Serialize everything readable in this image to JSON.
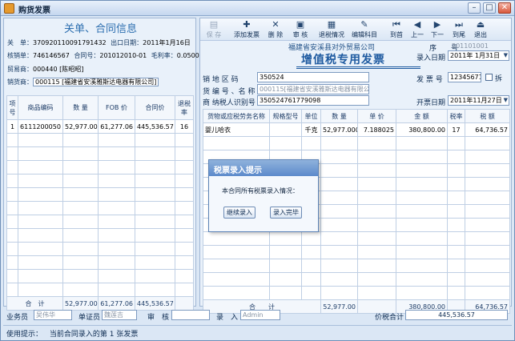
{
  "window": {
    "title": "购货发票"
  },
  "left": {
    "title": "关单、合同信息",
    "customs_label": "关　单：",
    "customs_no": "370920110091791432",
    "export_date_label": "出口日期：",
    "export_date": "2011年1月16日",
    "verify_label": "核销单：",
    "verify_no": "746146567",
    "contract_label": "合同号：",
    "contract_no": "201012010-01",
    "margin_label": "毛利率：",
    "margin": "0.0500",
    "trader_label": "贸易商：",
    "trader": "000440 [陈昭昭]",
    "supplier_label": "销货商：",
    "supplier": "000115 [福建省安溪雅斯达电器有限公司]",
    "table": {
      "headers": [
        "项号",
        "商品编码",
        "数 量",
        "FOB 价",
        "合同价",
        "退税率"
      ],
      "rows": [
        [
          "1",
          "6111200050",
          "52,977.000",
          "61,277.06",
          "445,536.57",
          "16"
        ]
      ],
      "total_label": "合　计",
      "totals": [
        "52,977.000",
        "61,277.06",
        "445,536.57"
      ]
    }
  },
  "toolbar": {
    "items": [
      {
        "label": "保 存",
        "icon": "save-icon",
        "glyph": "▤",
        "disabled": true
      },
      {
        "label": "添加发票",
        "icon": "add-invoice-icon",
        "glyph": "✚",
        "disabled": false
      },
      {
        "label": "删 除",
        "icon": "delete-icon",
        "glyph": "✕",
        "disabled": false
      },
      {
        "label": "审 核",
        "icon": "audit-icon",
        "glyph": "▣",
        "disabled": false
      },
      {
        "label": "退税情况",
        "icon": "refund-status-icon",
        "glyph": "▦",
        "disabled": false
      },
      {
        "label": "编辑科目",
        "icon": "edit-account-icon",
        "glyph": "✎",
        "disabled": false
      },
      {
        "label": "到首",
        "icon": "first-icon",
        "glyph": "⏮",
        "disabled": false
      },
      {
        "label": "上一",
        "icon": "prev-icon",
        "glyph": "◀",
        "disabled": false
      },
      {
        "label": "下一",
        "icon": "next-icon",
        "glyph": "▶",
        "disabled": false
      },
      {
        "label": "到尾",
        "icon": "last-icon",
        "glyph": "⏭",
        "disabled": false
      },
      {
        "label": "退出",
        "icon": "exit-icon",
        "glyph": "⏏",
        "disabled": false
      }
    ]
  },
  "invoice": {
    "company": "福建省安溪县对外贸易公司",
    "title": "增值税专用发票",
    "seq_label": "序　　号",
    "seq_no": "201101001",
    "entry_date_label": "录入日期",
    "entry_date": "2011年 1月31日",
    "invoice_no_label": "发 票 号",
    "invoice_no": "12345671",
    "split_label": "拆",
    "open_date_label": "开票日期",
    "open_date": "2011年11月27日",
    "seller_code_label": "销 地 区 码",
    "seller_code": "350524",
    "seller_name_label": "货 编 号 、名 称",
    "seller_name": "000115[福建省安溪雅斯达电器有限公司]",
    "taxid_label": "商 纳税人识别号",
    "taxid": "350524761779098",
    "table": {
      "headers": [
        "货物或应税劳务名称",
        "规格型号",
        "单位",
        "数 量",
        "单 价",
        "金 额",
        "税率",
        "税 额"
      ],
      "rows": [
        [
          "婴儿哈衣",
          "",
          "千克",
          "52,977.000",
          "7.188025",
          "380,800.00",
          "17",
          "64,736.57"
        ]
      ],
      "total_label": "合　　计",
      "totals": {
        "qty": "52,977.00",
        "amount": "380,800.00",
        "tax": "64,736.57"
      }
    }
  },
  "dialog": {
    "title": "税票录入提示",
    "message": "本合同所有税票录入情况：",
    "continue_label": "继续录入",
    "done_label": "录入完毕"
  },
  "bottom": {
    "salesman_label": "业务员",
    "salesman": "吴伟华",
    "voucher_label": "单证员",
    "voucher": "魏莲吉",
    "audit_label": "审　核",
    "audit": "",
    "entry_label": "录　入",
    "entry": "Admin",
    "total_label": "价税合计",
    "total": "445,536.57"
  },
  "status": {
    "prefix": "使用提示：",
    "text": "当前合同录入的第 1 张发票"
  }
}
